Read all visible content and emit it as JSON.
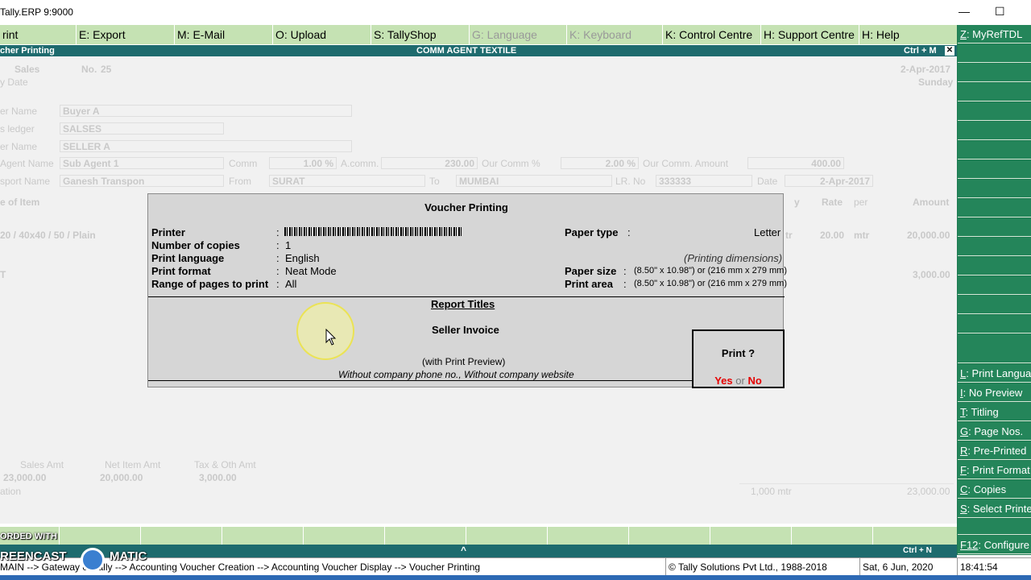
{
  "window": {
    "title": "Tally.ERP 9:9000",
    "minimize": "—",
    "maximize": "☐"
  },
  "menu": [
    {
      "key": "",
      "label": "rint",
      "disabled": false
    },
    {
      "key": "E",
      "label": ": Export",
      "disabled": false
    },
    {
      "key": "M",
      "label": ": E-Mail",
      "disabled": false
    },
    {
      "key": "O",
      "label": ": Upload",
      "disabled": false
    },
    {
      "key": "S",
      "label": ": TallyShop",
      "disabled": false
    },
    {
      "key": "G",
      "label": ": Language",
      "disabled": true
    },
    {
      "key": "K",
      "label": ": Keyboard",
      "disabled": true
    },
    {
      "key": "K",
      "label": ": Control Centre",
      "disabled": false
    },
    {
      "key": "H",
      "label": ": Support Centre",
      "disabled": false
    },
    {
      "key": "H",
      "label": ": Help",
      "disabled": false
    }
  ],
  "header": {
    "left": "cher Printing",
    "center": "COMM AGENT TEXTILE",
    "shortcut": "Ctrl + M",
    "close": "✕"
  },
  "background": {
    "voucher_type": "Sales",
    "voucher_no_label": "No.",
    "voucher_no": "25",
    "date": "2-Apr-2017",
    "day": "Sunday",
    "ref_label": "y Date",
    "buyer_label": "er Name",
    "buyer": "Buyer A",
    "ledger_label": "s ledger",
    "ledger": "SALSES",
    "seller_label": "er Name",
    "seller": "SELLER A",
    "agent_label": "Agent Name",
    "agent": "Sub Agent 1",
    "comm_label": "Comm",
    "comm": "1.00 %",
    "acomm_label": "A.comm.",
    "acomm": "230.00",
    "our_comm_pct_label": "Our Comm %",
    "our_comm_pct": "2.00 %",
    "our_comm_amt_label": "Our Comm. Amount",
    "our_comm_amt": "400.00",
    "transport_label": "sport Name",
    "transport": "Ganesh Transpon",
    "from_label": "From",
    "from": "SURAT",
    "to_label": "To",
    "to": "MUMBAI",
    "lr_label": "LR. No",
    "lr": "333333",
    "lr_date_label": "Date",
    "lr_date": "2-Apr-2017",
    "col_item": "e of Item",
    "col_y": "y",
    "col_rate": "Rate",
    "col_per": "per",
    "col_amount": "Amount",
    "item1": "20 / 40x40 / 50 / Plain",
    "item1_unit": "tr",
    "item1_rate": "20.00",
    "item1_per": "mtr",
    "item1_amount": "20,000.00",
    "item2": "T",
    "item2_amount": "3,000.00",
    "sales_amt_label": "Sales Amt",
    "sales_amt": "23,000.00",
    "net_item_label": "Net Item Amt",
    "net_item": "20,000.00",
    "tax_label": "Tax & Oth Amt",
    "tax": "3,000.00",
    "narration_label": "ation",
    "total_qty": "1,000 mtr",
    "total_amount": "23,000.00"
  },
  "dialog": {
    "title": "Voucher Printing",
    "printer_label": "Printer",
    "copies_label": "Number of copies",
    "copies": "1",
    "language_label": "Print language",
    "language": "English",
    "format_label": "Print format",
    "format": "Neat Mode",
    "range_label": "Range of pages to print",
    "range": "All",
    "paper_type_label": "Paper type",
    "paper_type": "Letter",
    "dimensions_note": "(Printing dimensions)",
    "paper_size_label": "Paper size",
    "paper_size": "(8.50\" x 10.98\") or (216 mm x 279 mm)",
    "print_area_label": "Print area",
    "print_area": "(8.50\" x 10.98\") or (216 mm x 279 mm)",
    "report_titles": "Report Titles",
    "report_name": "Seller Invoice",
    "preview_note": "(with Print Preview)",
    "company_note": "Without company phone no., Without company website",
    "colon": ":"
  },
  "print_prompt": {
    "question": "Print ?",
    "yes": "Yes",
    "or": "or",
    "no": "No"
  },
  "sidebar": {
    "top": {
      "key": "Z",
      "label": ": MyRefTDL"
    },
    "items": [
      {
        "key": "L",
        "label": ": Print Language"
      },
      {
        "key": "I",
        "label": ": No Preview"
      },
      {
        "key": "T",
        "label": ": Titling"
      },
      {
        "key": "G",
        "label": ": Page Nos."
      },
      {
        "key": "R",
        "label": ": Pre-Printed"
      },
      {
        "key": "F",
        "label": ": Print Format"
      },
      {
        "key": "C",
        "label": ": Copies"
      },
      {
        "key": "S",
        "label": ": Select Printer"
      }
    ],
    "bottom": {
      "key": "F12",
      "label": ": Configure"
    }
  },
  "bottom": {
    "shortcut": "Ctrl + N",
    "arrow": "^"
  },
  "status": {
    "breadcrumb": "MAIN --> Gateway of Tally --> Accounting Voucher  Creation  --> Accounting Voucher  Display  --> Voucher Printing",
    "copyright": "© Tally Solutions Pvt Ltd., 1988-2018",
    "date": "Sat, 6 Jun, 2020",
    "time": "18:41:54"
  },
  "watermark": {
    "line1": "ORDED WITH",
    "line2": "REENCAST",
    "line3": "MATIC"
  }
}
